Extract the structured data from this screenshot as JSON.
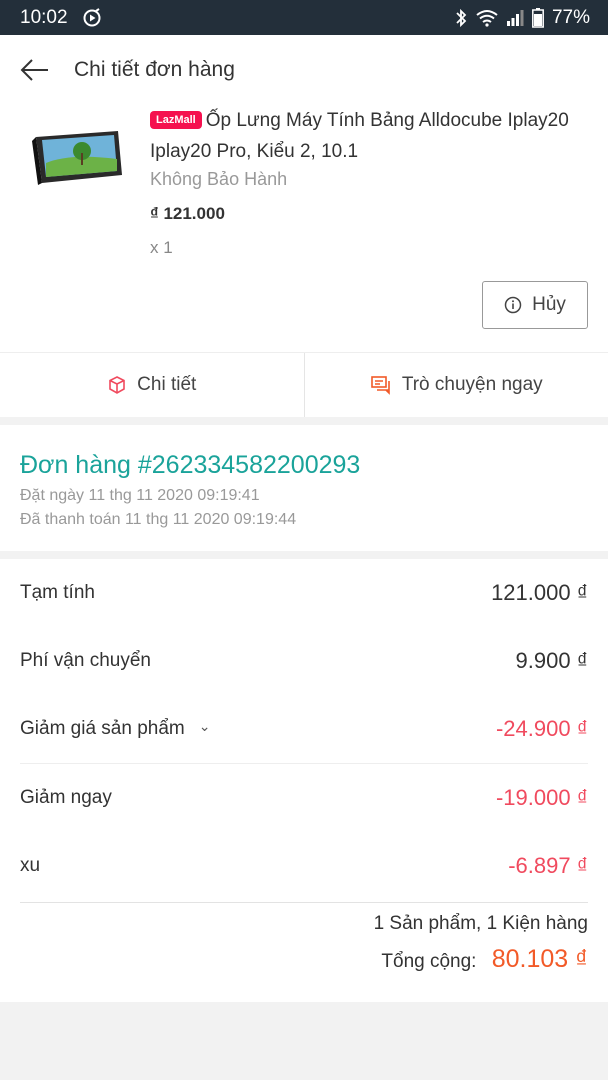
{
  "status_bar": {
    "time": "10:02",
    "battery": "77%"
  },
  "header": {
    "title": "Chi tiết đơn hàng"
  },
  "product": {
    "badge": "LazMall",
    "title": "Ốp Lưng Máy Tính Bảng Alldocube Iplay20 Iplay20 Pro, Kiểu 2, 10.1",
    "variant": "Không Bảo Hành",
    "price": "₫ 121.000",
    "quantity": "x 1",
    "cancel_label": "Hủy"
  },
  "actions": {
    "details_label": "Chi tiết",
    "chat_label": "Trò chuyện ngay"
  },
  "order": {
    "number": "Đơn hàng #262334582200293",
    "placed": "Đặt ngày 11 thg 11 2020  09:19:41",
    "paid": "Đã thanh toán 11 thg 11 2020  09:19:44"
  },
  "summary": {
    "subtotal_label": "Tạm tính",
    "subtotal_value": "121.000 ₫",
    "shipping_label": "Phí vận chuyển",
    "shipping_value": "9.900 ₫",
    "product_discount_label": "Giảm giá sản phẩm",
    "product_discount_value": "-24.900 ₫",
    "instant_discount_label": "Giảm ngay",
    "instant_discount_value": "-19.000 ₫",
    "coins_label": "xu",
    "coins_value": "-6.897 ₫",
    "counts": "1 Sản phẩm, 1 Kiện hàng",
    "total_label": "Tổng cộng:",
    "total_value": "80.103 ₫"
  },
  "colors": {
    "accent_teal": "#1aa39a",
    "negative": "#f04a5e",
    "total_orange": "#f25a28",
    "badge_pink": "#f5114f",
    "status_bar": "#232f3a"
  }
}
